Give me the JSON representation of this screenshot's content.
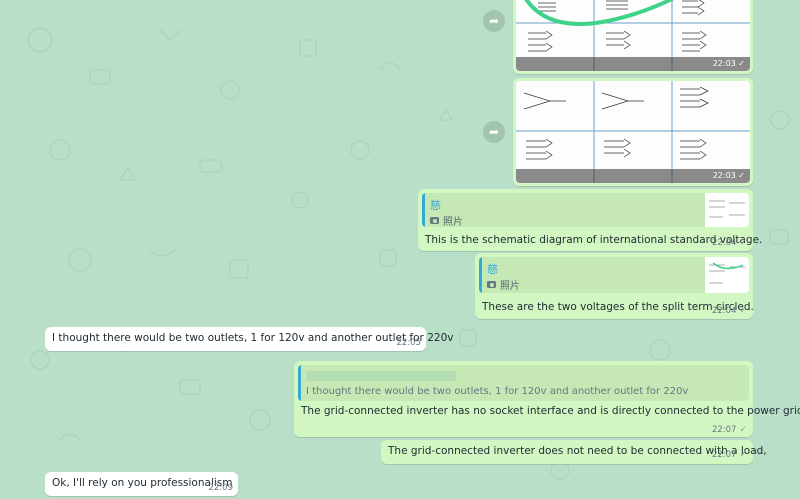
{
  "forward_icon": "share-forward-icon",
  "images": [
    {
      "time": "22:03",
      "ticks": "✓"
    },
    {
      "time": "22:03",
      "ticks": "✓"
    }
  ],
  "messages": [
    {
      "direction": "out",
      "quote": {
        "sender": "慈",
        "caption": "照片"
      },
      "text": "This is the schematic diagram of international standard voltage.",
      "time": "22:04",
      "ticks": "✓"
    },
    {
      "direction": "out",
      "quote": {
        "sender": "慈",
        "caption": "照片"
      },
      "text": "These are the two voltages of the split term circled.",
      "time": "22:04",
      "ticks": "✓"
    },
    {
      "direction": "in",
      "text": "I thought there would be two outlets, 1 for 120v and another outlet for 220v",
      "time": "22:05"
    },
    {
      "direction": "out",
      "quote": {
        "text": "I thought there would be two outlets, 1 for 120v and another outlet for 220v"
      },
      "text": "The grid-connected inverter has no socket interface and is directly connected to the power grid.",
      "time": "22:07",
      "ticks": "✓"
    },
    {
      "direction": "out",
      "text": "The grid-connected inverter does not need to be connected with a load,",
      "time": "22:07",
      "ticks": "✓"
    },
    {
      "direction": "in",
      "text": "Ok, I'll rely on you professionalism",
      "time": "22:09"
    }
  ]
}
